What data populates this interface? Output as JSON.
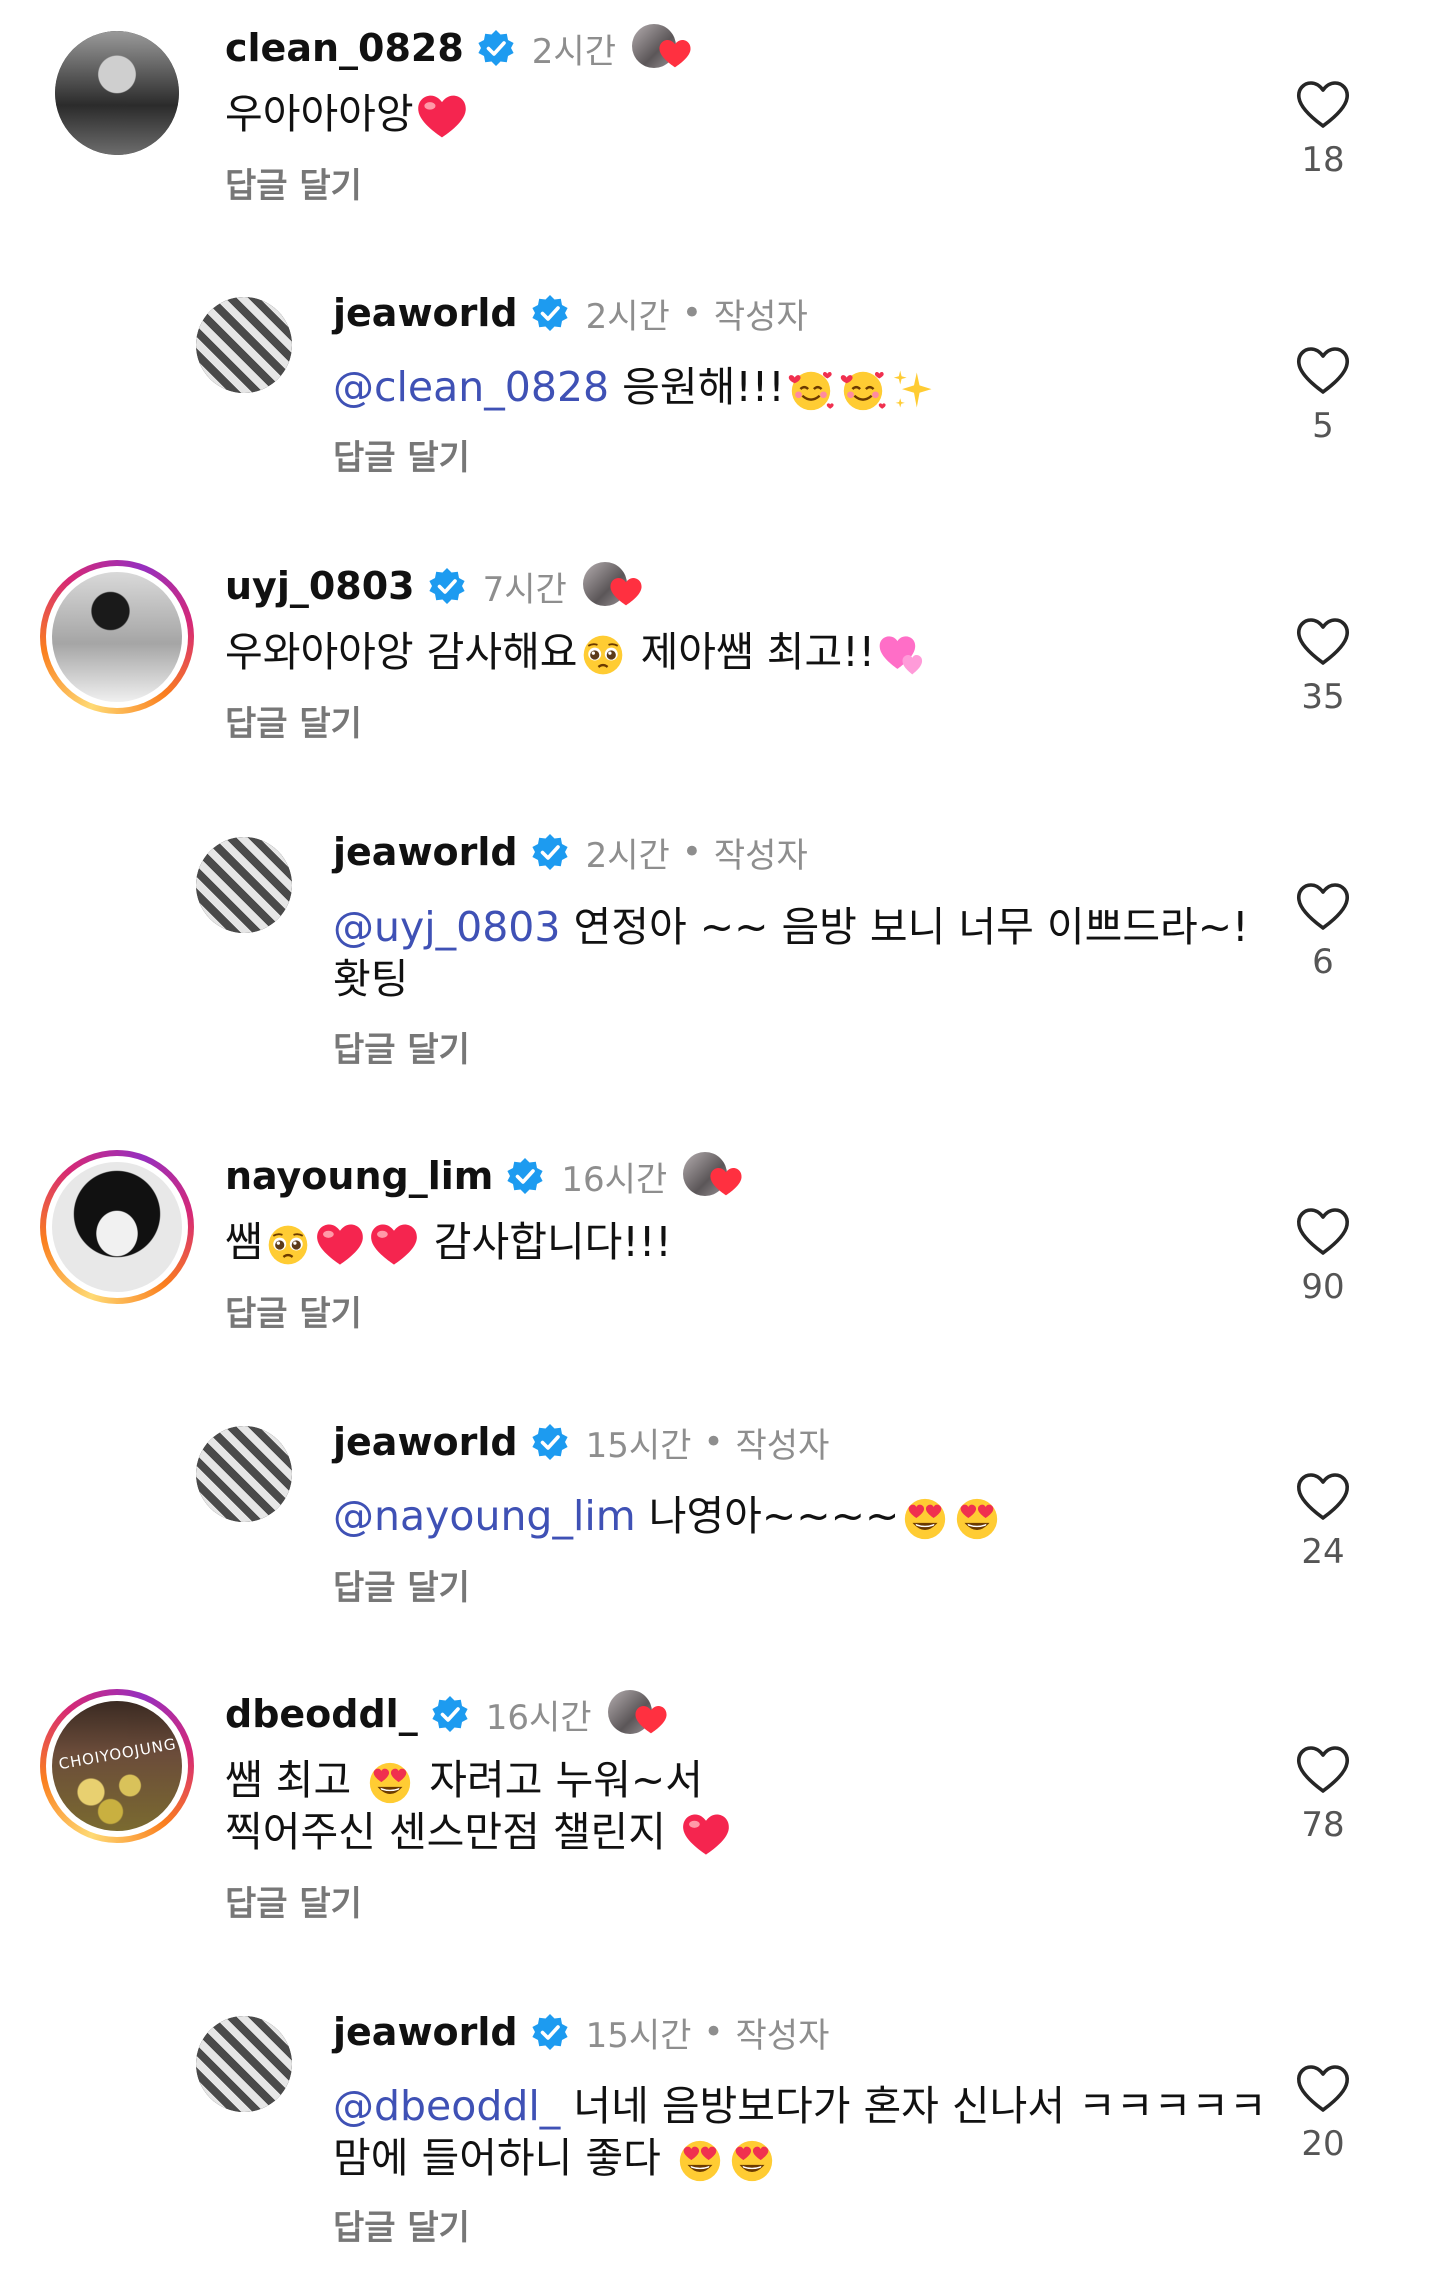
{
  "comments": [
    {
      "username": "clean_0828",
      "time": "2시간",
      "text": "우아아아앙",
      "likes": "18",
      "reply": "답글 달기"
    },
    {
      "username": "jeaworld",
      "time": "2시간",
      "author": "작성자",
      "mention": "@clean_0828",
      "text": "응원해!!!",
      "likes": "5",
      "reply": "답글 달기"
    },
    {
      "username": "uyj_0803",
      "time": "7시간",
      "text_a": "우와아아앙 감사해요",
      "text_b": "제아쌤 최고!!",
      "likes": "35",
      "reply": "답글 달기"
    },
    {
      "username": "jeaworld",
      "time": "2시간",
      "author": "작성자",
      "mention": "@uyj_0803",
      "text": "연정아 ~~ 음방 보니 너무 이쁘드라~!",
      "text2": "홧팅",
      "likes": "6",
      "reply": "답글 달기"
    },
    {
      "username": "nayoung_lim",
      "time": "16시간",
      "text_a": "쌤",
      "text_b": "감사합니다!!!",
      "likes": "90",
      "reply": "답글 달기"
    },
    {
      "username": "jeaworld",
      "time": "15시간",
      "author": "작성자",
      "mention": "@nayoung_lim",
      "text": "나영아~~~~",
      "likes": "24",
      "reply": "답글 달기"
    },
    {
      "username": "dbeoddl_",
      "time": "16시간",
      "text_a": "쌤 최고",
      "text_b": "자려고 누워~서",
      "text2": "찍어주신 센스만점 챌린지",
      "likes": "78",
      "reply": "답글 달기"
    },
    {
      "username": "jeaworld",
      "time": "15시간",
      "author": "작성자",
      "mention": "@dbeoddl_",
      "text": "너네 음방보다가 혼자 신나서 ㅋㅋㅋㅋㅋ",
      "text2": "맘에 들어하니 좋다",
      "likes": "20",
      "reply": "답글 달기"
    }
  ],
  "avatar_text": "CHOIYOOJUNG",
  "icons": {
    "like": "heart-outline-icon",
    "verified": "verified-badge-icon",
    "creator_like": "creator-liked-heart-icon"
  },
  "colors": {
    "verified": "#1d9bf0",
    "heart": "#ff3040",
    "mention": "#3f51b5",
    "muted": "#8e8e8e"
  }
}
